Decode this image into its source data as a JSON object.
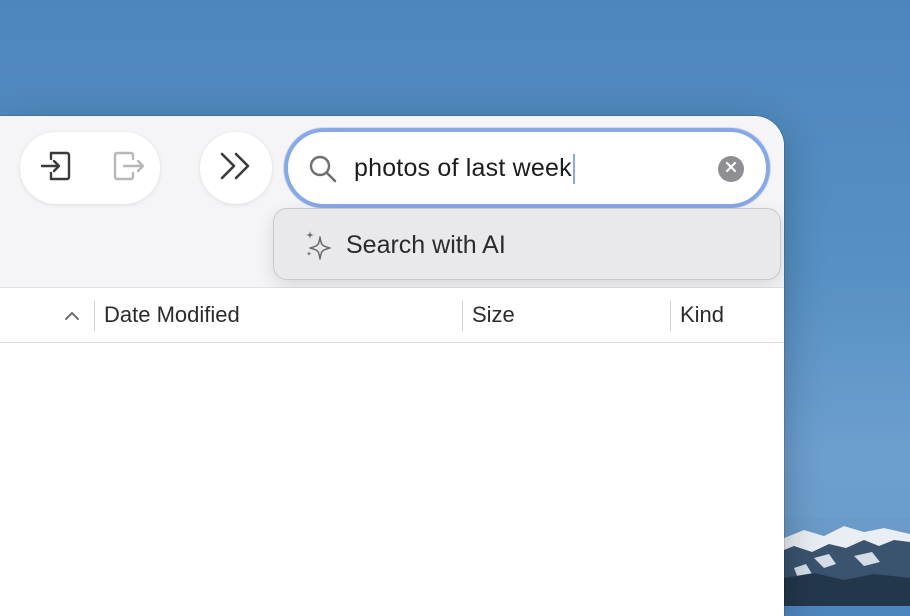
{
  "toolbar": {
    "buttons": [
      {
        "name": "enter-icon"
      },
      {
        "name": "exit-icon"
      },
      {
        "name": "chevron-double-right-icon"
      }
    ]
  },
  "search": {
    "value": "photos of last week",
    "icon": "search-icon",
    "clear_icon": "clear-icon"
  },
  "suggestion": {
    "label": "Search with AI",
    "icon": "sparkle-icon"
  },
  "table": {
    "columns": [
      "Date Modified",
      "Size",
      "Kind"
    ]
  },
  "colors": {
    "focus_ring": "#86a8e7",
    "desktop": "#4d86bd"
  }
}
